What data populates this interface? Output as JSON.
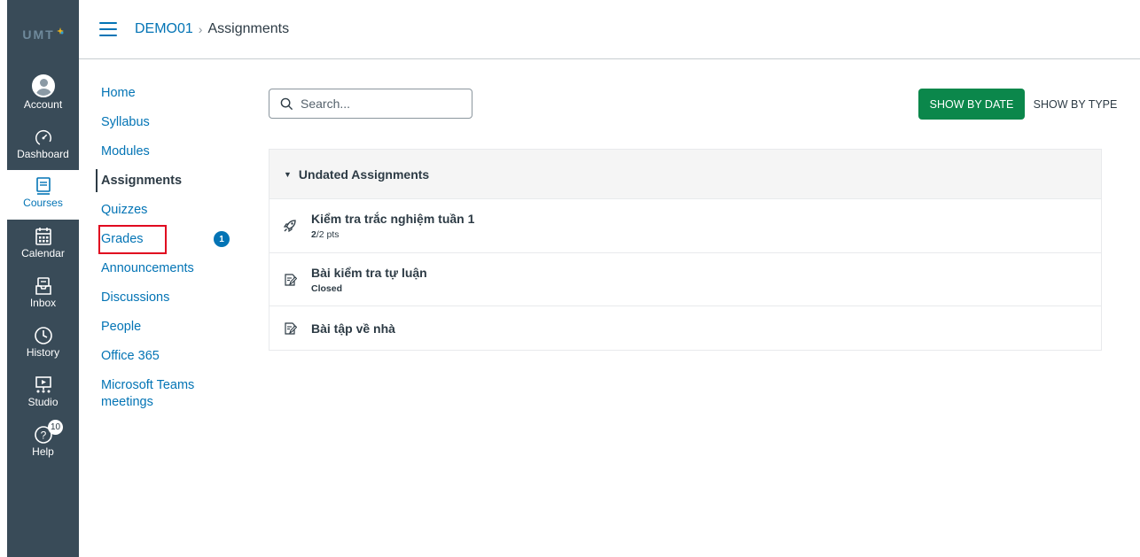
{
  "brand": {
    "logo_text": "UMT",
    "accent": "#0374b5",
    "rail_bg": "#394b58",
    "success": "#0b874b",
    "highlight": "#e0061f"
  },
  "global_nav": [
    {
      "id": "account",
      "label": "Account",
      "icon": "user-avatar-icon"
    },
    {
      "id": "dashboard",
      "label": "Dashboard",
      "icon": "dashboard-gauge-icon"
    },
    {
      "id": "courses",
      "label": "Courses",
      "icon": "book-icon",
      "active": true
    },
    {
      "id": "calendar",
      "label": "Calendar",
      "icon": "calendar-icon"
    },
    {
      "id": "inbox",
      "label": "Inbox",
      "icon": "inbox-icon"
    },
    {
      "id": "history",
      "label": "History",
      "icon": "clock-icon"
    },
    {
      "id": "studio",
      "label": "Studio",
      "icon": "studio-icon"
    },
    {
      "id": "help",
      "label": "Help",
      "icon": "help-icon",
      "badge": "10"
    }
  ],
  "breadcrumb": {
    "course": "DEMO01",
    "separator": "›",
    "current": "Assignments"
  },
  "course_nav": [
    {
      "label": "Home"
    },
    {
      "label": "Syllabus"
    },
    {
      "label": "Modules"
    },
    {
      "label": "Assignments",
      "active": true
    },
    {
      "label": "Quizzes"
    },
    {
      "label": "Grades",
      "badge": "1",
      "highlighted": true
    },
    {
      "label": "Announcements"
    },
    {
      "label": "Discussions"
    },
    {
      "label": "People"
    },
    {
      "label": "Office 365"
    },
    {
      "label": "Microsoft Teams meetings"
    }
  ],
  "toolbar": {
    "search_placeholder": "Search...",
    "show_by_date": "SHOW BY DATE",
    "show_by_type": "SHOW BY TYPE"
  },
  "assignment_group": {
    "title": "Undated Assignments",
    "items": [
      {
        "title": "Kiểm tra trắc nghiệm tuần 1",
        "score": "2",
        "points": "/2 pts",
        "icon": "quiz-rocket-icon"
      },
      {
        "title": "Bài kiểm tra tự luận",
        "status": "Closed",
        "icon": "assignment-icon"
      },
      {
        "title": "Bài tập về nhà",
        "icon": "assignment-icon"
      }
    ]
  }
}
